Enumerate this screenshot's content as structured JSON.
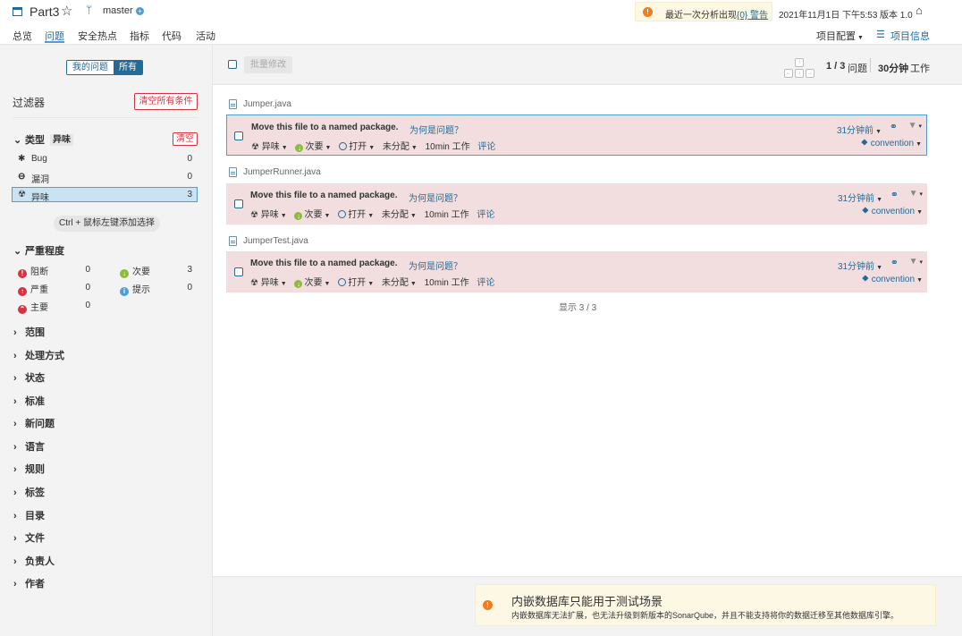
{
  "header": {
    "project_name": "Part3",
    "branch": "master",
    "warning_text": "最近一次分析出现",
    "warning_link": "{0} 警告",
    "analysis_date": "2021年11月1日 下午5:53",
    "version": "版本 1.0",
    "tabs": [
      "总览",
      "问题",
      "安全热点",
      "指标",
      "代码",
      "活动"
    ],
    "active_tab": "问题",
    "project_config": "项目配置",
    "project_info": "项目信息"
  },
  "sidebar": {
    "my_issues": "我的问题",
    "all": "所有",
    "filters_title": "过滤器",
    "clear_all": "清空所有条件",
    "type_facet": {
      "title": "类型",
      "badge": "异味",
      "clear": "清空",
      "items": [
        {
          "label": "Bug",
          "count": "0"
        },
        {
          "label": "漏洞",
          "count": "0"
        },
        {
          "label": "异味",
          "count": "3"
        }
      ]
    },
    "multi_select_hint": "Ctrl + 鼠标左键添加选择",
    "severity_facet": {
      "title": "严重程度",
      "items": [
        {
          "label": "阻断",
          "count": "0",
          "color": "#d4333f"
        },
        {
          "label": "次要",
          "count": "3",
          "color": "#8cbb3c"
        },
        {
          "label": "严重",
          "count": "0",
          "color": "#d4333f"
        },
        {
          "label": "提示",
          "count": "0",
          "color": "#4b9fd5"
        },
        {
          "label": "主要",
          "count": "0",
          "color": "#d4333f"
        }
      ]
    },
    "collapsed_facets": [
      "范围",
      "处理方式",
      "状态",
      "标准",
      "新问题",
      "语言",
      "规则",
      "标签",
      "目录",
      "文件",
      "负责人",
      "作者"
    ]
  },
  "toolbar": {
    "bulk_change": "批量修改",
    "issue_count": "1 / 3",
    "issue_label": "问题",
    "effort": "30分钟",
    "effort_label": "工作"
  },
  "issues": [
    {
      "file": "Jumper.java",
      "title": "Move this file to a named package.",
      "why": "为何是问题？",
      "type": "异味",
      "severity": "次要",
      "status": "打开",
      "assignee": "未分配",
      "effort": "10min 工作",
      "comment": "评论",
      "age": "31分钟前",
      "tag": "convention"
    },
    {
      "file": "JumperRunner.java",
      "title": "Move this file to a named package.",
      "why": "为何是问题？",
      "type": "异味",
      "severity": "次要",
      "status": "打开",
      "assignee": "未分配",
      "effort": "10min 工作",
      "comment": "评论",
      "age": "31分钟前",
      "tag": "convention"
    },
    {
      "file": "JumperTest.java",
      "title": "Move this file to a named package.",
      "why": "为何是问题？",
      "type": "异味",
      "severity": "次要",
      "status": "打开",
      "assignee": "未分配",
      "effort": "10min 工作",
      "comment": "评论",
      "age": "31分钟前",
      "tag": "convention"
    }
  ],
  "shown_count": "显示 3 / 3",
  "db_warning": {
    "title": "内嵌数据库只能用于测试场景",
    "body": "内嵌数据库无法扩展，也无法升级到新版本的SonarQube，并且不能支持将你的数据迁移至其他数据库引擎。"
  },
  "colors": {
    "accent": "#236a97",
    "issue_bg": "#f2dede",
    "warning_bg": "#fcf8e3",
    "danger": "#d4333f"
  }
}
